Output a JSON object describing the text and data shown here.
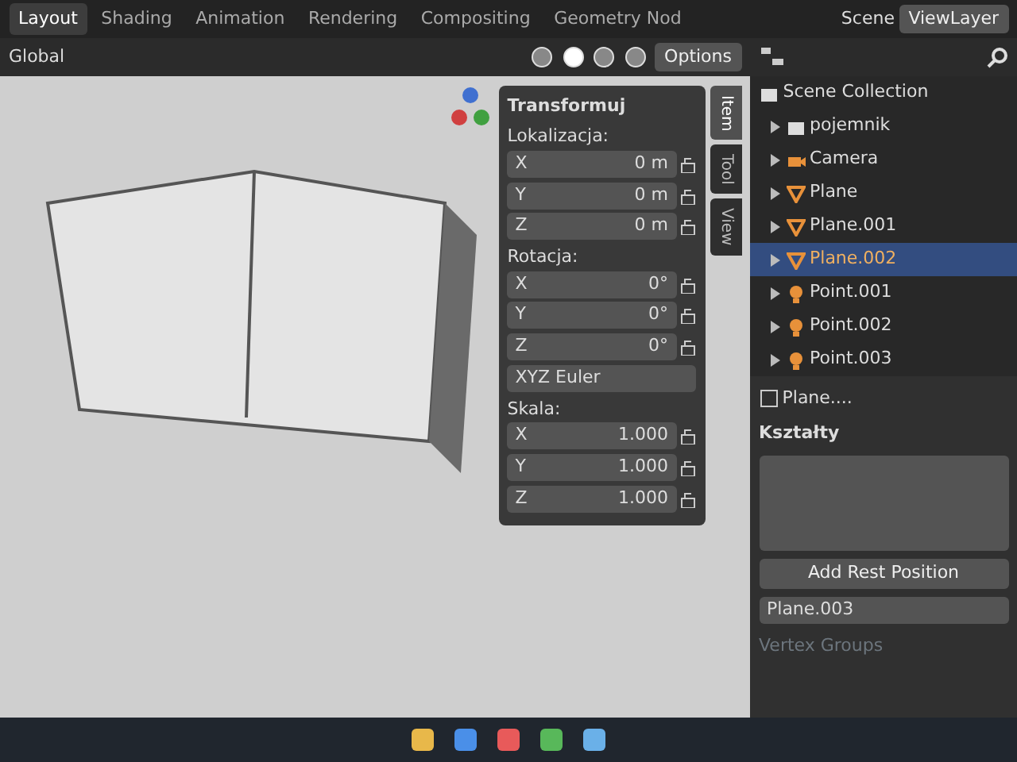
{
  "workspaces": [
    {
      "label": "Layout",
      "selected": true
    },
    {
      "label": "Shading",
      "selected": false
    },
    {
      "label": "Animation",
      "selected": false
    },
    {
      "label": "Rendering",
      "selected": false
    },
    {
      "label": "Compositing",
      "selected": false
    },
    {
      "label": "Geometry Nod",
      "selected": false
    }
  ],
  "scene": "Scene",
  "view_layer": "ViewLayer",
  "viewport_header": {
    "orientation": "Global",
    "options": "Options"
  },
  "transform_panel": {
    "title": "Transformuj",
    "sections": [
      {
        "title": "Lokalizacja:",
        "fields": [
          {
            "axis": "X",
            "value": "0 m"
          },
          {
            "axis": "Y",
            "value": "0 m"
          },
          {
            "axis": "Z",
            "value": "0 m"
          }
        ]
      },
      {
        "title": "Rotacja:",
        "fields": [
          {
            "axis": "X",
            "value": "0°"
          },
          {
            "axis": "Y",
            "value": "0°"
          },
          {
            "axis": "Z",
            "value": "0°"
          }
        ],
        "mode": "XYZ Euler"
      },
      {
        "title": "Skala:",
        "fields": [
          {
            "axis": "X",
            "value": "1.000"
          },
          {
            "axis": "Y",
            "value": "1.000"
          },
          {
            "axis": "Z",
            "value": "1.000"
          }
        ]
      }
    ]
  },
  "sidebar_tabs": [
    {
      "label": "Item",
      "selected": true
    },
    {
      "label": "Tool",
      "selected": false
    },
    {
      "label": "View",
      "selected": false
    }
  ],
  "outliner": {
    "root": "Scene Collection",
    "items": [
      {
        "label": "pojemnik",
        "kind": "collection",
        "selected": false,
        "expanded": false
      },
      {
        "label": "Camera",
        "kind": "camera",
        "selected": false,
        "expanded": false
      },
      {
        "label": "Plane",
        "kind": "mesh",
        "selected": false,
        "expanded": false
      },
      {
        "label": "Plane.001",
        "kind": "mesh",
        "selected": false,
        "expanded": false
      },
      {
        "label": "Plane.002",
        "kind": "mesh",
        "selected": true,
        "expanded": false
      },
      {
        "label": "Point.001",
        "kind": "light",
        "selected": false,
        "expanded": false
      },
      {
        "label": "Point.002",
        "kind": "light",
        "selected": false,
        "expanded": false
      },
      {
        "label": "Point.003",
        "kind": "light",
        "selected": false,
        "expanded": false
      }
    ]
  },
  "properties": {
    "breadcrumb": "Plane....",
    "section": "Kształty",
    "button": "Add Rest Position",
    "mesh": "Plane.003",
    "subsection": "Vertex Groups"
  }
}
